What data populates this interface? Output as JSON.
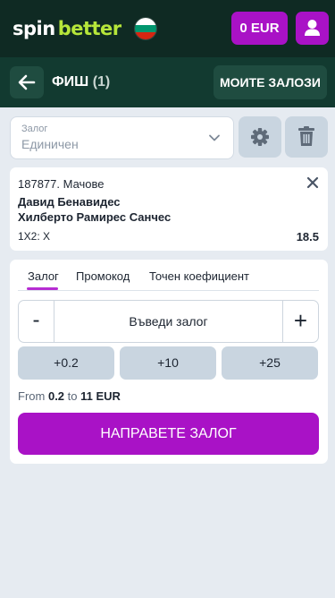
{
  "header": {
    "logo_spin": "spin",
    "logo_better": "better",
    "flag_colors": [
      "#ffffff",
      "#00966e",
      "#d62612"
    ],
    "balance": "0 EUR"
  },
  "slip": {
    "title": "ФИШ",
    "count": "(1)",
    "my_bets_label": "МОИТЕ ЗАЛОЗИ"
  },
  "bet_type": {
    "label": "Залог",
    "value": "Единичен"
  },
  "event": {
    "id_line": "187877. Мачове",
    "team1": "Давид Бенавидес",
    "team2": "Хилберто Рамирес Санчес",
    "market": "1X2: X",
    "odds": "18.5"
  },
  "stake": {
    "tabs": [
      "Залог",
      "Промокод",
      "Точен коефициент"
    ],
    "active_tab": "Залог",
    "minus": "-",
    "plus": "+",
    "placeholder": "Въведи залог",
    "quick_amounts": [
      "+0.2",
      "+10",
      "+25"
    ],
    "range_from_label": "From",
    "range_min": "0.2",
    "range_to_label": "to",
    "range_max": "11 EUR",
    "place_bet_label": "НАПРАВЕТЕ ЗАЛОГ"
  },
  "colors": {
    "accent": "#a912c6",
    "header_bg": "#0f2a23",
    "slip_header_bg": "#123a30",
    "brand_green": "#b6e63a"
  },
  "icons": [
    "user-icon",
    "arrow-left-icon",
    "chevron-down-icon",
    "gear-icon",
    "trash-icon",
    "close-icon"
  ]
}
